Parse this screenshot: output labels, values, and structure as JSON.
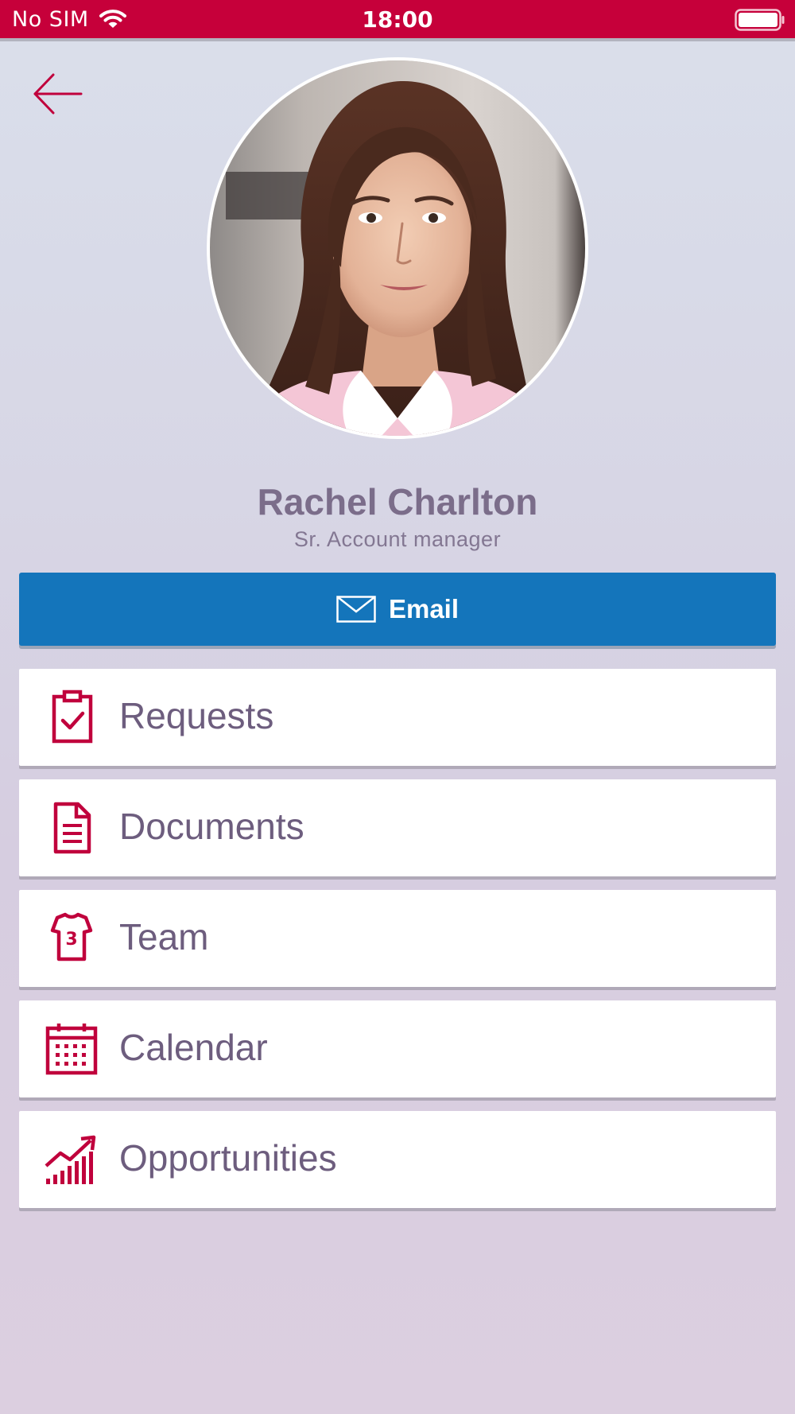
{
  "status_bar": {
    "carrier": "No SIM",
    "time": "18:00",
    "background_color": "#c6003a",
    "icons": [
      "wifi-icon",
      "battery-icon"
    ]
  },
  "navigation": {
    "back_icon": "arrow-left-icon"
  },
  "profile": {
    "name": "Rachel Charlton",
    "title": "Sr. Account manager"
  },
  "email_button": {
    "label": "Email",
    "icon": "mail-icon",
    "color": "#1475bb"
  },
  "menu": {
    "items": [
      {
        "label": "Requests",
        "icon": "clipboard-check-icon"
      },
      {
        "label": "Documents",
        "icon": "document-icon"
      },
      {
        "label": "Team",
        "icon": "jersey-icon"
      },
      {
        "label": "Calendar",
        "icon": "calendar-icon"
      },
      {
        "label": "Opportunities",
        "icon": "trend-up-chart-icon"
      }
    ],
    "icon_color": "#c0003c",
    "text_color": "#6d5d7e"
  }
}
